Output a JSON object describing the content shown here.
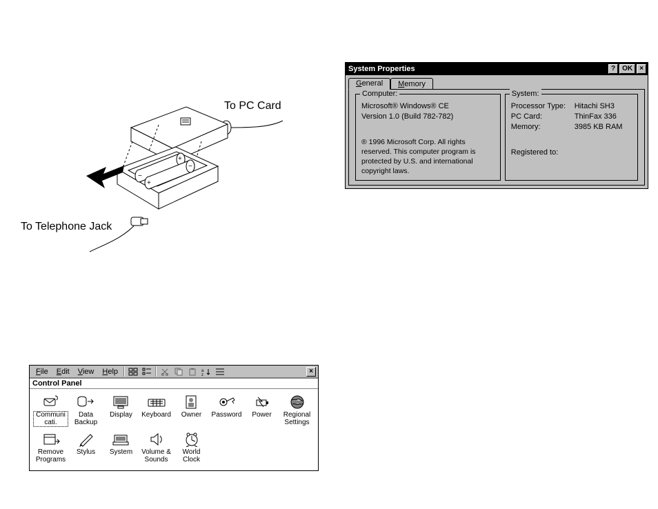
{
  "diagram": {
    "label_pc": "To PC Card",
    "label_tel": "To Telephone Jack"
  },
  "sysprops": {
    "title": "System Properties",
    "buttons": {
      "help": "?",
      "ok": "OK",
      "close": "×"
    },
    "tabs": {
      "general": "General",
      "general_u": "G",
      "memory": "Memory",
      "memory_u": "M"
    },
    "computer": {
      "legend": "Computer:",
      "line1": "Microsoft® Windows® CE",
      "line2": "Version 1.0 (Build 782-782)",
      "copyright": "® 1996 Microsoft Corp. All rights reserved. This computer program is protected by U.S. and international copyright laws."
    },
    "system": {
      "legend": "System:",
      "proc_label": "Processor Type:",
      "proc_value": "Hitachi SH3",
      "card_label": "PC Card:",
      "card_value": "ThinFax 336",
      "mem_label": "Memory:",
      "mem_value": "3985 KB   RAM",
      "reg_label": "Registered to:"
    }
  },
  "cpanel": {
    "menus": {
      "file": "File",
      "edit": "Edit",
      "view": "View",
      "help": "Help"
    },
    "caption": "Control Panel",
    "close": "×",
    "icons": [
      {
        "name": "Communicati."
      },
      {
        "name": "Data Backup"
      },
      {
        "name": "Display"
      },
      {
        "name": "Keyboard"
      },
      {
        "name": "Owner"
      },
      {
        "name": "Password"
      },
      {
        "name": "Power"
      },
      {
        "name": "Regional Settings"
      },
      {
        "name": "Remove Programs"
      },
      {
        "name": "Stylus"
      },
      {
        "name": "System"
      },
      {
        "name": "Volume & Sounds"
      },
      {
        "name": "World Clock"
      }
    ]
  }
}
